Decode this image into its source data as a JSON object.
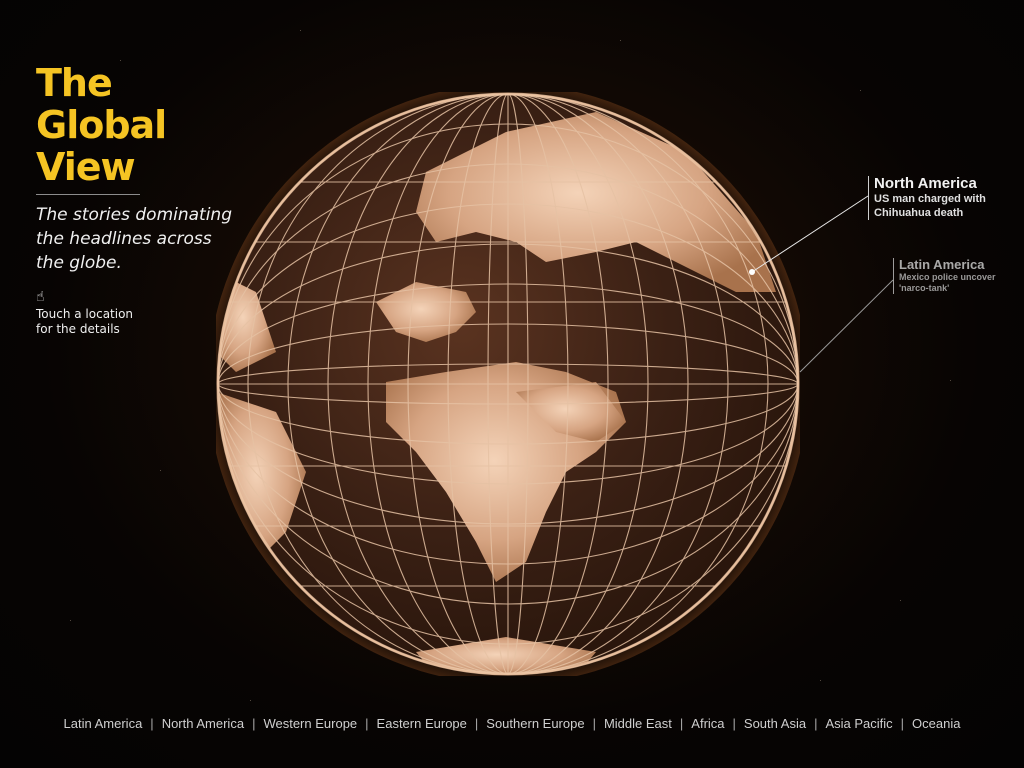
{
  "title": {
    "line1": "The",
    "line2": "Global",
    "line3": "View"
  },
  "subtitle": "The stories dominating the headlines across the globe.",
  "hint": {
    "icon": "pointing-hand-icon",
    "text": "Touch a location\nfor the details"
  },
  "callouts": {
    "north_america": {
      "region": "North America",
      "headline_line1": "US man charged with",
      "headline_line2": "Chihuahua death"
    },
    "latin_america": {
      "region": "Latin America",
      "headline_line1": "Mexico police uncover",
      "headline_line2": "'narco-tank'"
    }
  },
  "nav": {
    "items": [
      "Latin America",
      "North America",
      "Western Europe",
      "Eastern Europe",
      "Southern Europe",
      "Middle East",
      "Africa",
      "South Asia",
      "Asia Pacific",
      "Oceania"
    ],
    "separator": "|"
  },
  "colors": {
    "title": "#f5c423",
    "globe": "#c8926c",
    "background": "#070403"
  }
}
